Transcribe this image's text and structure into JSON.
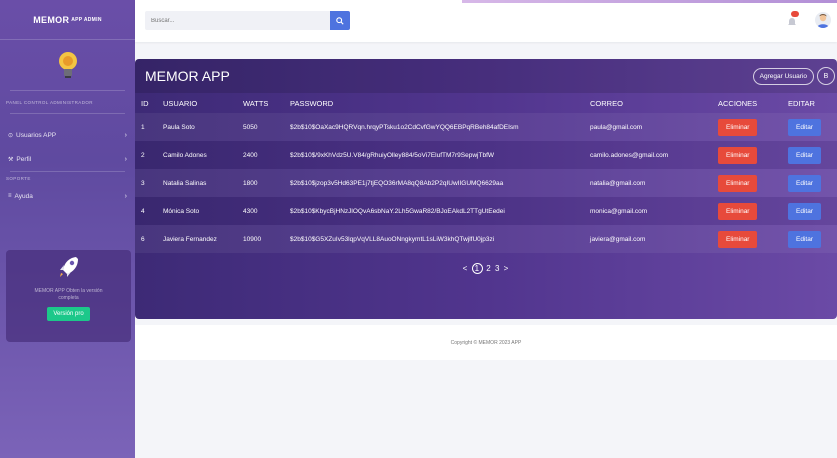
{
  "sidebar": {
    "brand": "MEMOR",
    "brand_sup": "APP ADMIN",
    "panel_heading": "PANEL CONTROL ADMINISTRADOR",
    "support_heading": "SOPORTE",
    "items": [
      {
        "label": "Usuarios APP",
        "icon": "circle-icon"
      },
      {
        "label": "Perfil",
        "icon": "wrench-icon"
      },
      {
        "label": "Ayuda",
        "icon": "bars-icon"
      }
    ],
    "promo_text": "MEMOR APP Obten la versión completa",
    "promo_button": "Versión pro"
  },
  "topbar": {
    "search_placeholder": "Buscar..."
  },
  "card": {
    "title": "MEMOR APP",
    "add_user_label": "Agregar Usuario",
    "round_button_label": "B",
    "columns": [
      "ID",
      "USUARIO",
      "WATTS",
      "PASSWORD",
      "CORREO",
      "ACCIONES",
      "EDITAR"
    ],
    "rows": [
      {
        "id": "1",
        "user": "Paula Soto",
        "watts": "5050",
        "password": "$2b$10$OaXac9HQRVqn.hrqyPTsku1o2CdCvfGwYQQ6EBPqRBeh84afDEIsm",
        "email": "paula@gmail.com",
        "delete": "Eliminar",
        "edit": "Editar"
      },
      {
        "id": "2",
        "user": "Camilo Adones",
        "watts": "2400",
        "password": "$2b$10$/9xKhVdz5U.V84/gRhuiyOlley884/5oVi7ElufTM7r9SepwjTbfW",
        "email": "camilo.adones@gmail.com",
        "delete": "Eliminar",
        "edit": "Editar"
      },
      {
        "id": "3",
        "user": "Natalia Salinas",
        "watts": "1800",
        "password": "$2b$10$jzop3v5Hd63PE1j7tjEQO36rMA8qQ8Ab2P2qIUwIIGUMQ6629aa",
        "email": "natalia@gmail.com",
        "delete": "Eliminar",
        "edit": "Editar"
      },
      {
        "id": "4",
        "user": "Mónica Soto",
        "watts": "4300",
        "password": "$2b$10$KbycBjHNzJlOQvA6sbNaY.2Lh5GwaR82/BJoEAkdL2TTgUtEedei",
        "email": "monica@gmail.com",
        "delete": "Eliminar",
        "edit": "Editar"
      },
      {
        "id": "6",
        "user": "Javiera Fernandez",
        "watts": "10900",
        "password": "$2b$10$G5XZuIv53lqpVqVLL8AuoONngkymtL1sLiW3khQTwjlfU0jp3zi",
        "email": "javiera@gmail.com",
        "delete": "Eliminar",
        "edit": "Editar"
      }
    ],
    "pager": {
      "prev": "<",
      "current": "1",
      "p2": "2",
      "p3": "3",
      "next": ">"
    }
  },
  "footer": {
    "text": "Copyright © MEMOR 2023 APP"
  },
  "colors": {
    "accent": "#4e73df",
    "danger": "#e74a3b",
    "success": "#1cc88a",
    "card_bg": "#51358e"
  }
}
